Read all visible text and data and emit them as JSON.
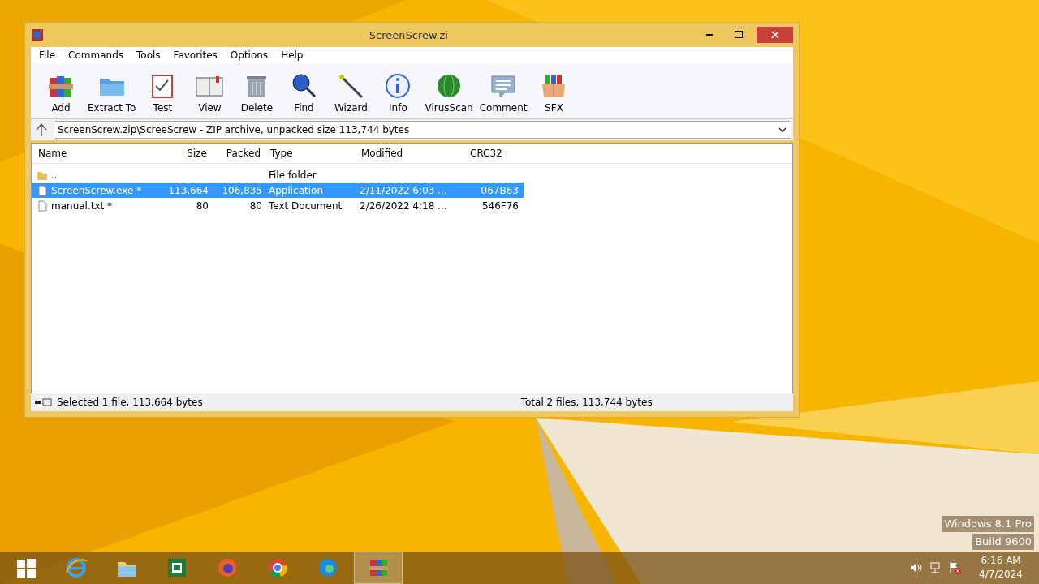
{
  "window": {
    "title": "ScreenScrew.zi",
    "menu": [
      "File",
      "Commands",
      "Tools",
      "Favorites",
      "Options",
      "Help"
    ],
    "toolbar": [
      "Add",
      "Extract To",
      "Test",
      "View",
      "Delete",
      "Find",
      "Wizard",
      "Info",
      "VirusScan",
      "Comment",
      "SFX"
    ],
    "address": "ScreenScrew.zip\\ScreeScrew - ZIP archive, unpacked size 113,744 bytes",
    "columns": [
      "Name",
      "Size",
      "Packed",
      "Type",
      "Modified",
      "CRC32"
    ],
    "rows": [
      {
        "kind": "folder",
        "name": "..",
        "size": "",
        "packed": "",
        "type": "File folder",
        "modified": "",
        "crc": "",
        "selected": false
      },
      {
        "kind": "file",
        "name": "ScreenScrew.exe *",
        "size": "113,664",
        "packed": "106,835",
        "type": "Application",
        "modified": "2/11/2022 6:03 ...",
        "crc": "067B63",
        "selected": true
      },
      {
        "kind": "file",
        "name": "manual.txt *",
        "size": "80",
        "packed": "80",
        "type": "Text Document",
        "modified": "2/26/2022 4:18 ...",
        "crc": "546F76",
        "selected": false
      }
    ],
    "status_left": "Selected 1 file, 113,664 bytes",
    "status_right": "Total 2 files, 113,744 bytes"
  },
  "os_label": [
    "Windows 8.1 Pro",
    "Build 9600"
  ],
  "taskbar": {
    "apps": [
      {
        "selected": false
      },
      {
        "selected": false
      },
      {
        "selected": false
      },
      {
        "selected": false
      },
      {
        "selected": false
      },
      {
        "selected": false
      },
      {
        "selected": false
      },
      {
        "selected": true
      }
    ],
    "time": "6:16 AM",
    "date": "4/7/2024"
  }
}
